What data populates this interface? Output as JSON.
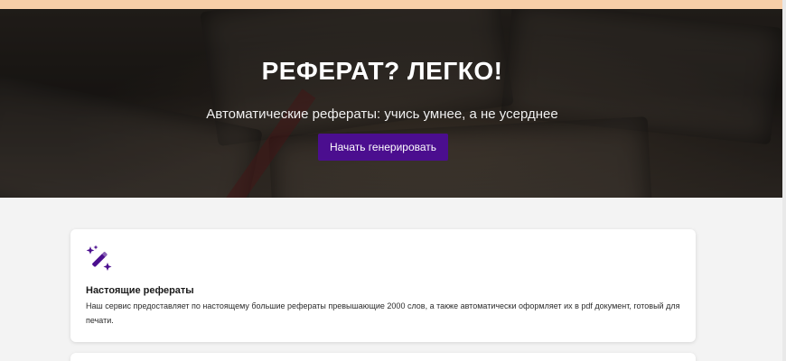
{
  "hero": {
    "title": "РЕФЕРАТ? ЛЕГКО!",
    "subtitle": "Автоматические рефераты: учись умнее, а не усерднее",
    "cta_label": "Начать генерировать"
  },
  "features": [
    {
      "icon": "magic-wand-icon",
      "title": "Настоящие рефераты",
      "text": "Наш сервис предоставляет по настоящему большие рефераты превышающие 2000 слов, а также автоматически оформляет их в pdf документ, готовый для печати."
    }
  ],
  "colors": {
    "accent": "#4b0e8f",
    "top_strip": "#f8cfa8",
    "background": "#f3f3f3"
  }
}
